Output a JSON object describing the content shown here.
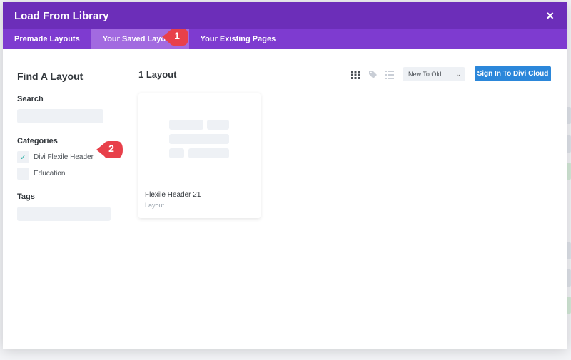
{
  "modal": {
    "title": "Load From Library",
    "close_label": "×"
  },
  "tabs": [
    {
      "label": "Premade Layouts"
    },
    {
      "label": "Your Saved Layouts"
    },
    {
      "label": "Your Existing Pages"
    }
  ],
  "active_tab": "Your Saved Layouts",
  "sidebar": {
    "title": "Find A Layout",
    "search_label": "Search",
    "search_value": "",
    "categories_label": "Categories",
    "categories": [
      {
        "label": "Divi Flexile Header",
        "checked": true
      },
      {
        "label": "Education",
        "checked": false
      }
    ],
    "tags_label": "Tags",
    "tags_value": ""
  },
  "main": {
    "layout_count": "1 Layout",
    "sort_value": "New To Old",
    "cloud_button": "Sign In To Divi Cloud",
    "card": {
      "title": "Flexile Header 21",
      "type": "Layout"
    }
  },
  "callouts": [
    {
      "number": "1"
    },
    {
      "number": "2"
    }
  ],
  "colors": {
    "header": "#6c2eb9",
    "tabbar": "#7e3bd0",
    "active_tab": "#a26ae0",
    "cloud_button": "#2b87da",
    "callout": "#e8404a",
    "checkmark": "#2bb0a6"
  }
}
